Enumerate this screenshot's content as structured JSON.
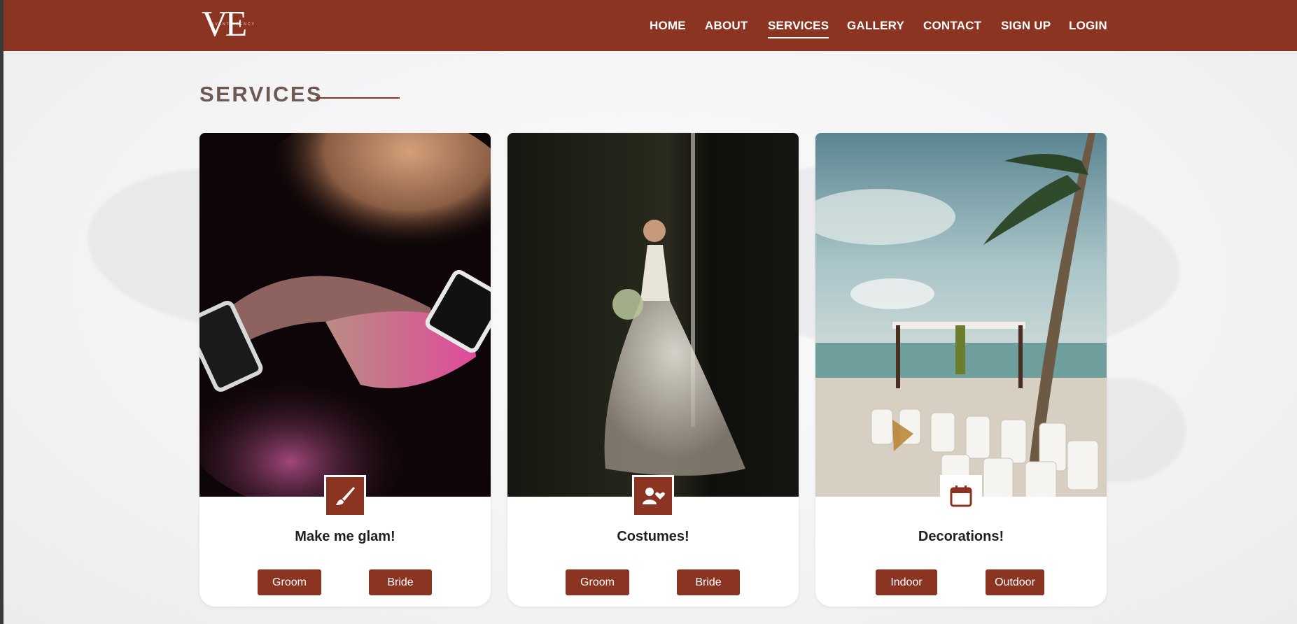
{
  "header": {
    "logo_mark": "VE",
    "logo_sub": "EVENT AGENCY",
    "nav": [
      {
        "label": "HOME"
      },
      {
        "label": "ABOUT"
      },
      {
        "label": "SERVICES"
      },
      {
        "label": "GALLERY"
      },
      {
        "label": "CONTACT"
      },
      {
        "label": "SIGN UP"
      },
      {
        "label": "LOGIN"
      }
    ],
    "active_nav": "SERVICES"
  },
  "section": {
    "title": "SERVICES"
  },
  "cards": [
    {
      "title": "Make me glam!",
      "icon": "brush-icon",
      "photo": "makeup-brushes-powder",
      "buttons": [
        {
          "label": "Groom"
        },
        {
          "label": "Bride"
        }
      ]
    },
    {
      "title": "Costumes!",
      "icon": "user-heart-icon",
      "photo": "bride-in-white-dress",
      "buttons": [
        {
          "label": "Groom"
        },
        {
          "label": "Bride"
        }
      ]
    },
    {
      "title": "Decorations!",
      "icon": "calendar-icon",
      "photo": "beach-wedding-setup",
      "buttons": [
        {
          "label": "Indoor"
        },
        {
          "label": "Outdoor"
        }
      ]
    }
  ],
  "colors": {
    "brand": "#8b3422",
    "title_text": "#6e5955",
    "card_title": "#1f1f1f"
  }
}
